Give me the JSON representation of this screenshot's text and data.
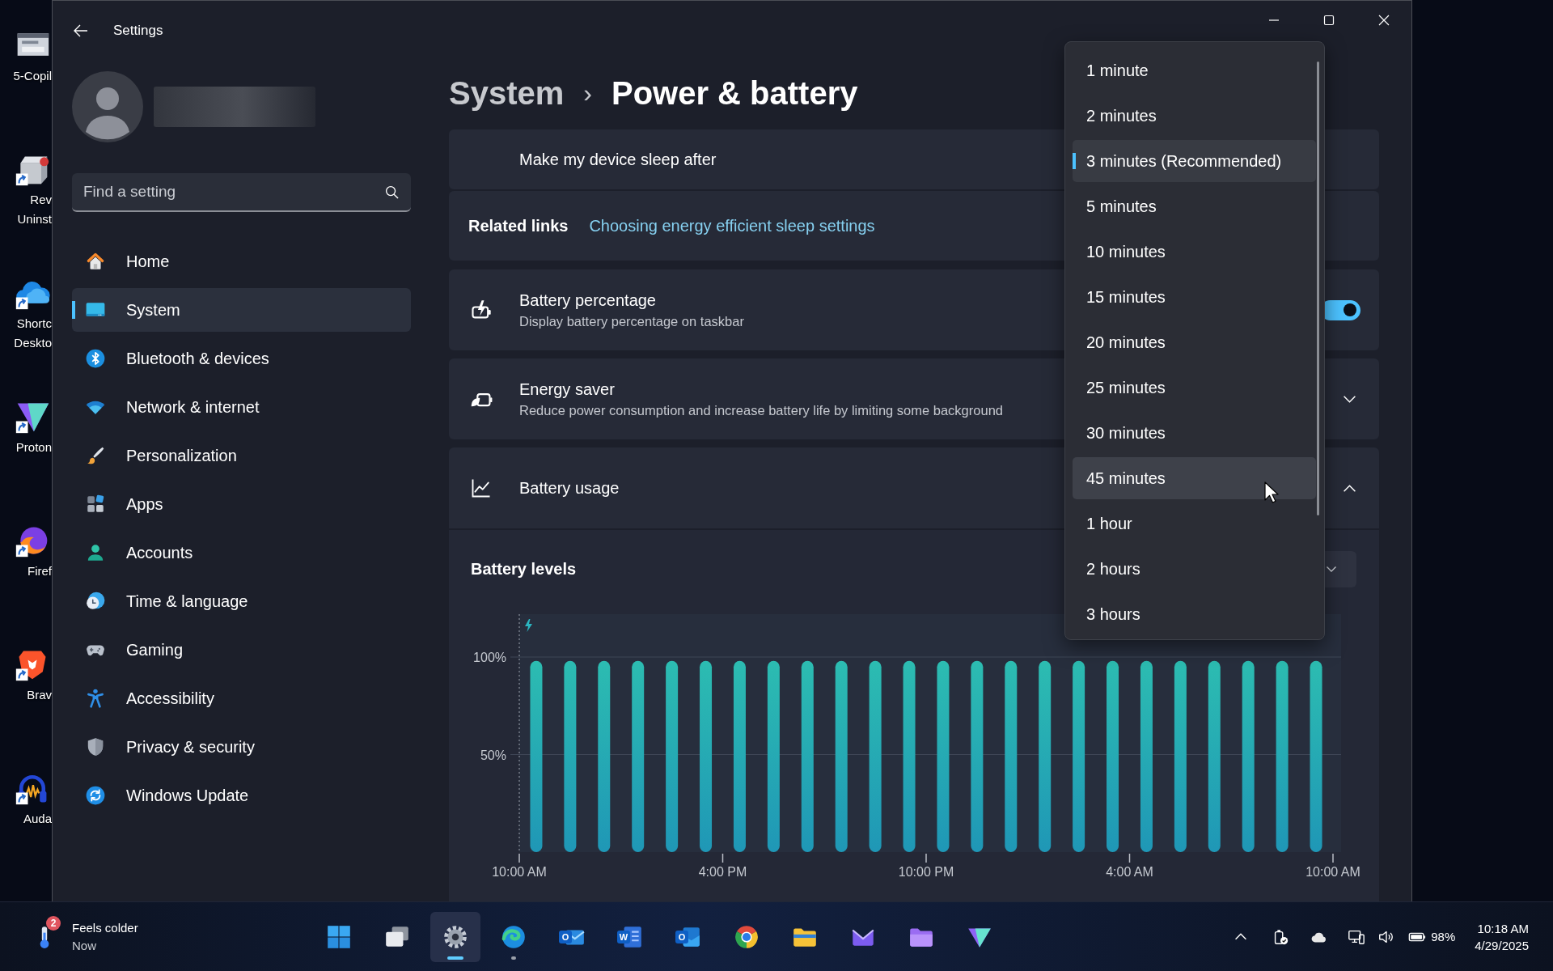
{
  "desktop_icons": [
    {
      "label_lines": [
        "5-Copil"
      ],
      "shortcut": false
    },
    {
      "label_lines": [
        "Rev",
        "Uninst"
      ],
      "shortcut": true
    },
    {
      "label_lines": [
        "Shortc",
        "Deskto"
      ],
      "shortcut": true
    },
    {
      "label_lines": [
        "Proton"
      ],
      "shortcut": true
    },
    {
      "label_lines": [
        "Firef"
      ],
      "shortcut": true
    },
    {
      "label_lines": [
        "Brav"
      ],
      "shortcut": true
    },
    {
      "label_lines": [
        "Auda"
      ],
      "shortcut": true
    }
  ],
  "window": {
    "title": "Settings"
  },
  "sidebar": {
    "search": {
      "placeholder": "Find a setting"
    },
    "items": [
      {
        "label": "Home",
        "selected": false
      },
      {
        "label": "System",
        "selected": true
      },
      {
        "label": "Bluetooth & devices",
        "selected": false
      },
      {
        "label": "Network & internet",
        "selected": false
      },
      {
        "label": "Personalization",
        "selected": false
      },
      {
        "label": "Apps",
        "selected": false
      },
      {
        "label": "Accounts",
        "selected": false
      },
      {
        "label": "Time & language",
        "selected": false
      },
      {
        "label": "Gaming",
        "selected": false
      },
      {
        "label": "Accessibility",
        "selected": false
      },
      {
        "label": "Privacy & security",
        "selected": false
      },
      {
        "label": "Windows Update",
        "selected": false
      }
    ]
  },
  "breadcrumb": {
    "parent": "System",
    "separator": "›",
    "current": "Power & battery"
  },
  "cards": [
    {
      "kind": "select",
      "title": "Make my device sleep after"
    },
    {
      "kind": "links",
      "title": "Related links",
      "link": "Choosing energy efficient sleep settings"
    },
    {
      "kind": "toggle",
      "title": "Battery percentage",
      "description": "Display battery percentage on taskbar",
      "on": true
    },
    {
      "kind": "expander",
      "title": "Energy saver",
      "description": "Reduce power consumption and increase battery life by limiting some background",
      "expanded": false
    },
    {
      "kind": "expander",
      "title": "Battery usage",
      "expanded": true
    }
  ],
  "battery_levels": {
    "chart_data": {
      "type": "bar",
      "title": "Battery levels",
      "categories": [
        "10:00 AM",
        null,
        null,
        null,
        null,
        null,
        "4:00 PM",
        null,
        null,
        null,
        null,
        null,
        "10:00 PM",
        null,
        null,
        null,
        null,
        null,
        "4:00 AM",
        null,
        null,
        null,
        null,
        null,
        "10:00 AM"
      ],
      "values": [
        98,
        98,
        98,
        98,
        98,
        98,
        98,
        98,
        98,
        98,
        98,
        98,
        98,
        98,
        98,
        98,
        98,
        98,
        98,
        98,
        98,
        98,
        98,
        98,
        null
      ],
      "ylim": [
        0,
        122
      ],
      "yticks": [
        {
          "value": 50,
          "label": "50%"
        },
        {
          "value": 100,
          "label": "100%"
        }
      ]
    }
  },
  "sleep_menu": {
    "items": [
      {
        "label": "1 minute",
        "selected": false,
        "hovered": false
      },
      {
        "label": "2 minutes",
        "selected": false,
        "hovered": false
      },
      {
        "label": "3 minutes (Recommended)",
        "selected": true,
        "hovered": false
      },
      {
        "label": "5 minutes",
        "selected": false,
        "hovered": false
      },
      {
        "label": "10 minutes",
        "selected": false,
        "hovered": false
      },
      {
        "label": "15 minutes",
        "selected": false,
        "hovered": false
      },
      {
        "label": "20 minutes",
        "selected": false,
        "hovered": false
      },
      {
        "label": "25 minutes",
        "selected": false,
        "hovered": false
      },
      {
        "label": "30 minutes",
        "selected": false,
        "hovered": false
      },
      {
        "label": "45 minutes",
        "selected": false,
        "hovered": true
      },
      {
        "label": "1 hour",
        "selected": false,
        "hovered": false
      },
      {
        "label": "2 hours",
        "selected": false,
        "hovered": false
      },
      {
        "label": "3 hours",
        "selected": false,
        "hovered": false
      }
    ]
  },
  "taskbar": {
    "weather": {
      "badge": "2",
      "title": "Feels colder",
      "subtitle": "Now"
    },
    "apps": [
      {
        "active": false,
        "running": false
      },
      {
        "active": false,
        "running": false
      },
      {
        "active": true,
        "running": true
      },
      {
        "active": false,
        "running": true
      },
      {
        "glyph": "O",
        "active": false,
        "running": false
      },
      {
        "glyph": "W",
        "active": false,
        "running": false
      },
      {
        "glyph": "O",
        "active": false,
        "running": false
      },
      {
        "active": false,
        "running": false
      },
      {
        "active": false,
        "running": false
      },
      {
        "active": false,
        "running": false
      },
      {
        "active": false,
        "running": false
      },
      {
        "active": false,
        "running": false
      }
    ],
    "tray": {
      "battery": "98%",
      "time": "10:18 AM",
      "date": "4/29/2025"
    }
  }
}
